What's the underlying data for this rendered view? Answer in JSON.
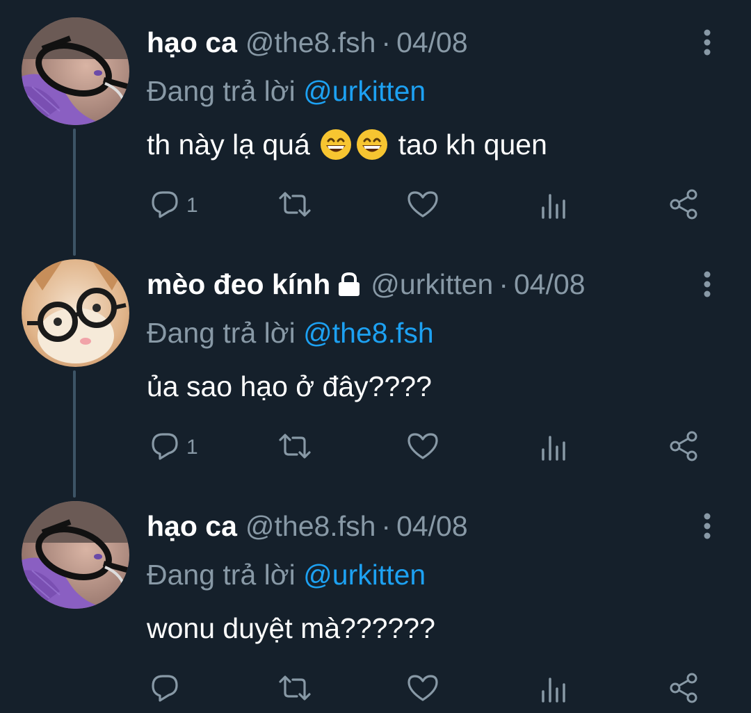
{
  "thread": {
    "tweets": [
      {
        "name": "hạo ca",
        "handle": "@the8.fsh",
        "separator": "·",
        "date": "04/08",
        "locked": false,
        "avatar": "avatar-glasses-purple-scarf",
        "reply_prefix": "Đang trả lời",
        "reply_to": "@urkitten",
        "text_before": "th này lạ quá ",
        "emojis": [
          "grinning-face-with-smiling-eyes-emoji",
          "grinning-face-with-smiling-eyes-emoji"
        ],
        "text_after": " tao kh quen",
        "reply_count": "1"
      },
      {
        "name": "mèo đeo kính",
        "handle": "@urkitten",
        "separator": "·",
        "date": "04/08",
        "locked": true,
        "avatar": "avatar-cat-with-glasses",
        "reply_prefix": "Đang trả lời",
        "reply_to": "@the8.fsh",
        "text_before": "ủa sao hạo ở đây????",
        "emojis": [],
        "text_after": "",
        "reply_count": "1"
      },
      {
        "name": "hạo ca",
        "handle": "@the8.fsh",
        "separator": "·",
        "date": "04/08",
        "locked": false,
        "avatar": "avatar-glasses-purple-scarf",
        "reply_prefix": "Đang trả lời",
        "reply_to": "@urkitten",
        "text_before": "wonu duyệt mà??????",
        "emojis": [],
        "text_after": "",
        "reply_count": ""
      }
    ]
  },
  "icons": {
    "reply": "reply-icon",
    "retweet": "retweet-icon",
    "like": "like-icon",
    "analytics": "analytics-icon",
    "share": "share-icon",
    "more": "more-vertical-icon",
    "lock": "lock-icon"
  },
  "colors": {
    "background": "#15202b",
    "text_primary": "#ffffff",
    "text_secondary": "#8899a6",
    "link": "#1da1f2",
    "thread_line": "#3d5466"
  }
}
